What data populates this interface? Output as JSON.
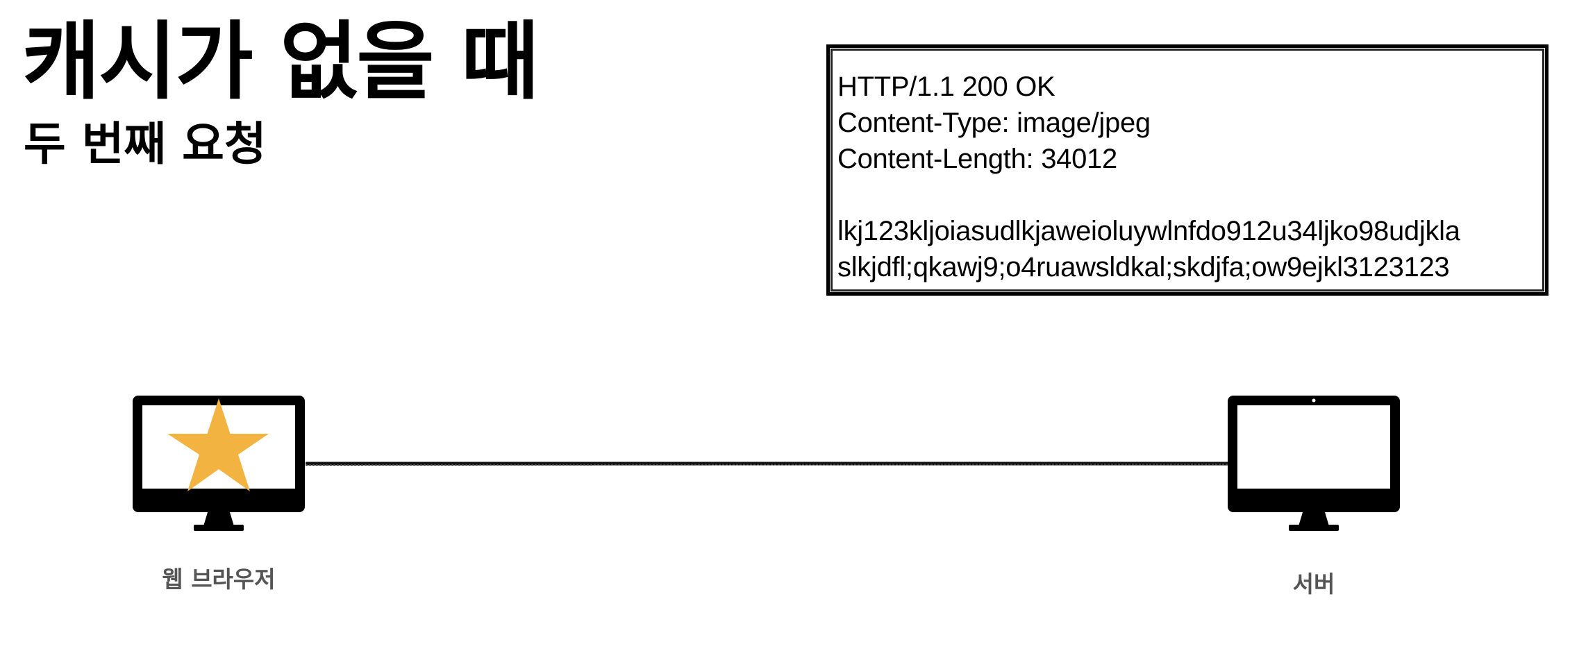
{
  "slide": {
    "title": "캐시가 없을 때",
    "subtitle": "두 번째 요청"
  },
  "response": {
    "lines": [
      "HTTP/1.1 200 OK",
      "Content-Type: image/jpeg",
      "Content-Length: 34012",
      "",
      "lkj123kljoiasudlkjaweioluywlnfdo912u34ljko98udjkla",
      "slkjdfl;qkawj9;o4ruawsldkal;skdjfa;ow9ejkl3123123"
    ]
  },
  "client": {
    "label": "웹 브라우저",
    "icon": "monitor-icon",
    "content_icon": "star-icon",
    "star_color": "#F2B340"
  },
  "server": {
    "label": "서버",
    "icon": "monitor-icon"
  },
  "colors": {
    "label_gray": "#555555",
    "line": "#111111"
  }
}
